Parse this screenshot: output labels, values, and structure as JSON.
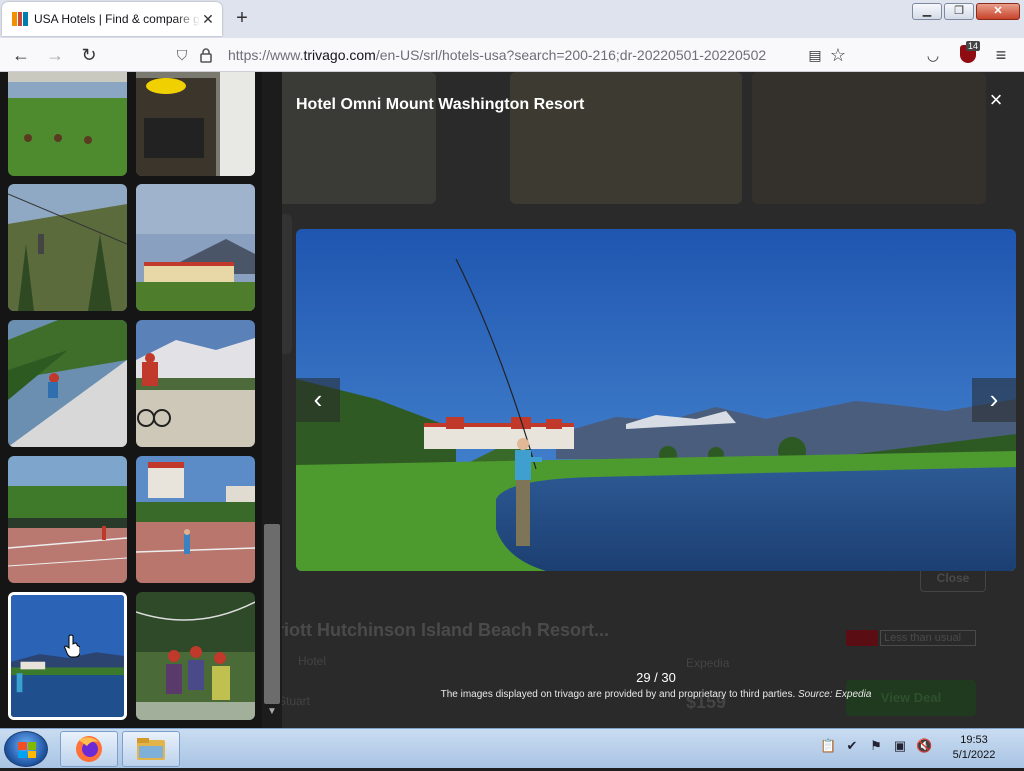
{
  "browser": {
    "tab": {
      "title": "USA Hotels | Find & compare great deals on trivago"
    },
    "url": {
      "prefix": "https://www.",
      "host": "trivago.com",
      "path": "/en-US/srl/hotels-usa?search=200-216;dr-20220501-20220502"
    },
    "extension_badge": "14"
  },
  "background": {
    "hotel_name": "arriott Hutchinson Island Beach Resort...",
    "hotel_type": "Hotel",
    "location": "Stuart",
    "provider": "Expedia",
    "price": "$159",
    "less_than_usual": "Less than usual",
    "close_label": "Close",
    "deal_label": "View Deal"
  },
  "lightbox": {
    "title": "Hotel Omni Mount Washington Resort",
    "counter": "29 / 30",
    "disclaimer": "The images displayed on trivago are provided by and proprietary to third parties.",
    "source_label": "Source:",
    "source_name": "Expedia",
    "close_icon": "×",
    "prev_icon": "‹",
    "next_icon": "›"
  },
  "taskbar": {
    "time": "19:53",
    "date": "5/1/2022"
  },
  "colors": {
    "sky": "#2b63b6",
    "grass": "#4d9a2e",
    "water": "#25518c",
    "trivago_red": "#c94a38",
    "trivago_orange": "#f48f00",
    "trivago_blue": "#007faf"
  }
}
